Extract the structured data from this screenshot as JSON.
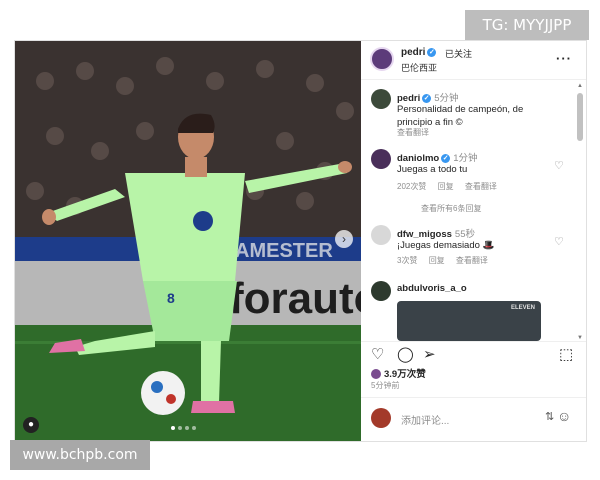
{
  "watermarks": {
    "top_right": "TG: MYYJJPP",
    "bottom_left": "www.bchpb.com"
  },
  "media": {
    "banner_text": "AMESTER",
    "ad_text": "forauto",
    "shirt_number": "8",
    "next_icon": "chevron-right-icon",
    "tag_icon": "user-tag-icon"
  },
  "header": {
    "username": "pedri",
    "follow_status": "已关注",
    "location": "巴伦西亚",
    "more_icon": "more-horizontal-icon"
  },
  "caption": {
    "username": "pedri",
    "time": "5分钟",
    "text": "Personalidad de campeón, de principio a fin ©",
    "translate": "查看翻译"
  },
  "comments": [
    {
      "username": "daniolmo",
      "verified": true,
      "time": "1分钟",
      "text": "Juegas a todo tu",
      "likes": "202次赞",
      "reply": "回复",
      "translate": "查看翻译",
      "view_replies": "查看所有6条回复"
    },
    {
      "username": "dfw_migoss",
      "verified": false,
      "time": "55秒",
      "text": "¡Juegas demasiado 🎩",
      "likes": "3次赞",
      "reply": "回复",
      "translate": "查看翻译"
    },
    {
      "username": "abdulvoris_a_o",
      "verified": false,
      "time": "",
      "text": "ELEVEN"
    }
  ],
  "actions": {
    "likes_count": "3.9万次赞",
    "posted_time": "5分钟前"
  },
  "comment_box": {
    "placeholder": "添加评论..."
  },
  "colors": {
    "pitch": "#2f6b2a",
    "kit": "#b8f4a8",
    "verified": "#3897f0"
  }
}
